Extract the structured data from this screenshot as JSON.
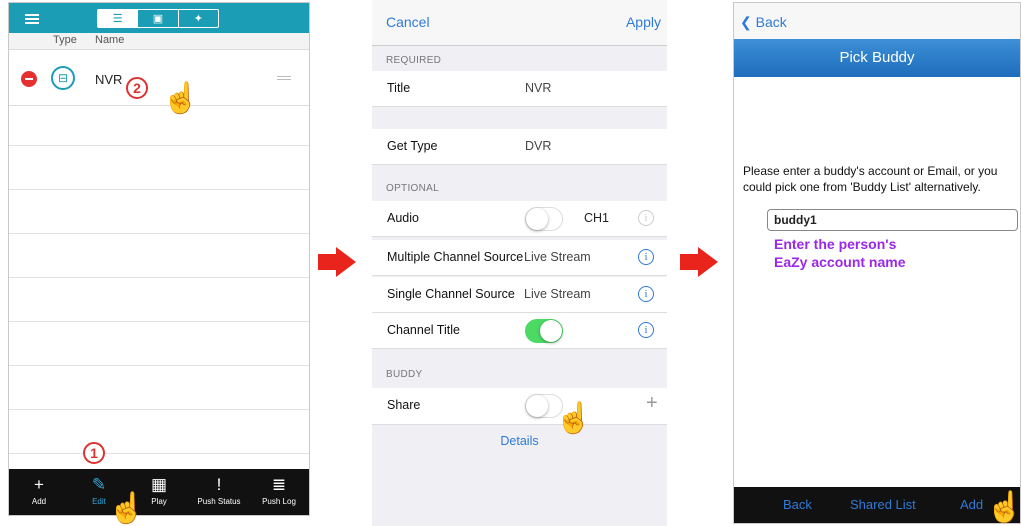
{
  "screen1": {
    "tabs": [
      "list-icon",
      "device-icon",
      "favorite-icon"
    ],
    "columns": {
      "type": "Type",
      "name": "Name"
    },
    "device": {
      "name": "NVR",
      "icon": "device-icon"
    },
    "toolbar": [
      {
        "label": "Add",
        "icon": "+"
      },
      {
        "label": "Edit",
        "icon": "✎"
      },
      {
        "label": "Play",
        "icon": "▦"
      },
      {
        "label": "Push Status",
        "icon": "!"
      },
      {
        "label": "Push Log",
        "icon": "≣"
      }
    ],
    "step_marks": {
      "one": "1",
      "two": "2"
    }
  },
  "screen2": {
    "cancel": "Cancel",
    "apply": "Apply",
    "required_header": "REQUIRED",
    "title": {
      "label": "Title",
      "value": "NVR"
    },
    "get_type": {
      "label": "Get Type",
      "value": "DVR"
    },
    "optional_header": "OPTIONAL",
    "audio": {
      "label": "Audio",
      "value": "CH1",
      "on": false
    },
    "multi": {
      "label": "Multiple Channel Source",
      "value": "Live Stream"
    },
    "single": {
      "label": "Single Channel Source",
      "value": "Live Stream"
    },
    "channel_title": {
      "label": "Channel Title",
      "on": true
    },
    "buddy_header": "BUDDY",
    "share": {
      "label": "Share",
      "on": false
    },
    "details": "Details",
    "plus": "+",
    "info_glyph": "i"
  },
  "screen3": {
    "back": "Back",
    "back_glyph": "❮",
    "title": "Pick Buddy",
    "description": "Please enter a buddy's account or Email, or you could pick one from 'Buddy List' alternatively.",
    "input_value": "buddy1",
    "note_line1": "Enter the person's",
    "note_line2": "EaZy account name",
    "bottom": {
      "back": "Back",
      "shared_list": "Shared List",
      "add": "Add"
    }
  },
  "colors": {
    "teal": "#1a9db5",
    "ios_blue": "#2f7ad8",
    "arrow_red": "#e8241c",
    "switch_green": "#4cd964",
    "note_purple": "#9b28e8",
    "step_red": "#d33"
  }
}
